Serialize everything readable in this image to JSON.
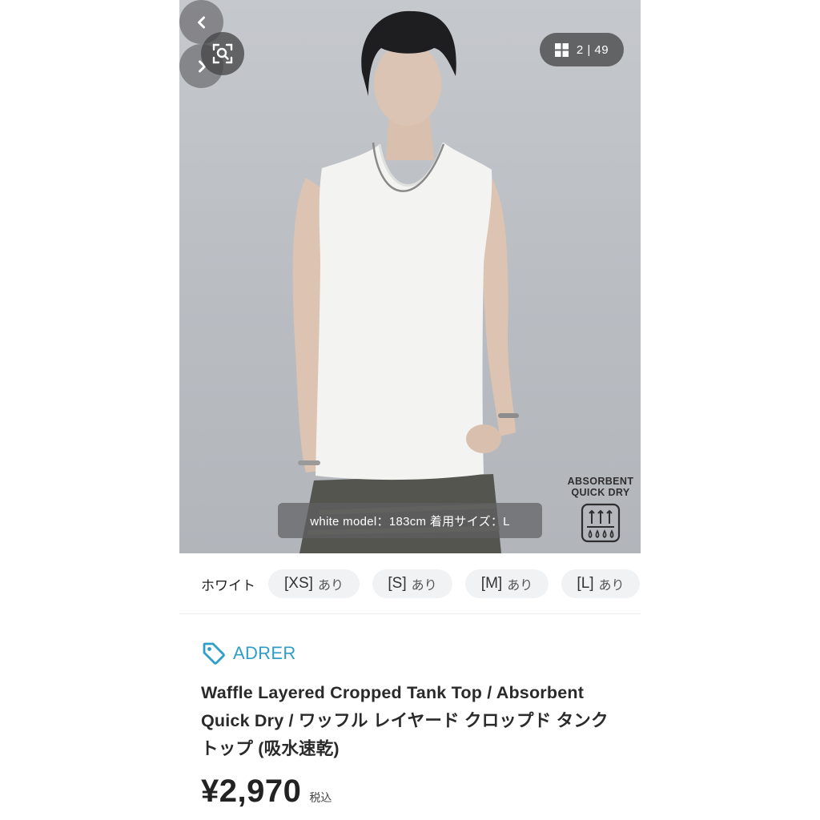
{
  "gallery": {
    "counter": "2 | 49",
    "caption": "white model：183cm 着用サイズ：L",
    "badge": {
      "line1": "ABSORBENT",
      "line2": "QUICK DRY",
      "icon": "water-drops-icon"
    },
    "icons": {
      "zoom": "zoom-search-icon",
      "grid": "grid-icon",
      "prev": "chevron-left-icon",
      "next": "chevron-right-icon"
    }
  },
  "sizes": {
    "color_label": "ホワイト",
    "items": [
      {
        "size": "[XS]",
        "stock": "あり"
      },
      {
        "size": "[S]",
        "stock": "あり"
      },
      {
        "size": "[M]",
        "stock": "あり"
      },
      {
        "size": "[L]",
        "stock": "あり"
      }
    ]
  },
  "product": {
    "brand": "ADRER",
    "brand_color": "#2f9ec8",
    "title": "Waffle Layered Cropped Tank Top / Absorbent Quick Dry / ワッフル レイヤード クロップド タンクトップ (吸水速乾)",
    "price": "¥2,970",
    "tax_label": "税込"
  }
}
